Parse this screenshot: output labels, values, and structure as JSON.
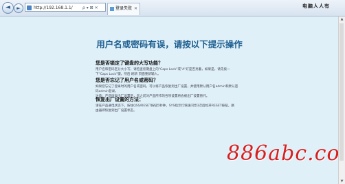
{
  "browser": {
    "back_glyph": "◄",
    "forward_glyph": "►",
    "address": "http://192.168.1.1/",
    "address_tools": "ρ ▾ ⊠ ✕",
    "tab_title": "登录失败",
    "tab_close": "✕"
  },
  "watermark_top": "电脑人人有",
  "page": {
    "title": "用户名或密码有误，请按以下提示操作",
    "sections": [
      {
        "heading": "您是否锁定了键盘的大写功能？",
        "lines": [
          "用户名和密码区分大小写，请检查您键盘上的\"Caps Lock\"或\"A\"灯是否亮着，如果是，请先按一",
          "下\"Caps Lock\"键，然后 刷新 页面重新输入。"
        ]
      },
      {
        "heading": "您是否忘记了用户名或密码？",
        "lines": [
          "如果您忘记了登录时的用户名或密码，可以将产品恢复到出厂设置，并使用默认用户名admin和默认密",
          "码admin登录。",
          "注意：产品恢复出厂设置后，您之前对产品所作的各项设置将会被出厂设置替代。"
        ]
      },
      {
        "heading": "恢复出厂设置的方法：",
        "lines": [
          "请在产品通电状态下，按住QSS/RESET按钮5秒钟，SYS指示灯快速闪烁3次后松开RESET按钮，路",
          "由器即恢复到出厂设置状态。"
        ]
      }
    ]
  },
  "brand_watermark": "886abc.com"
}
